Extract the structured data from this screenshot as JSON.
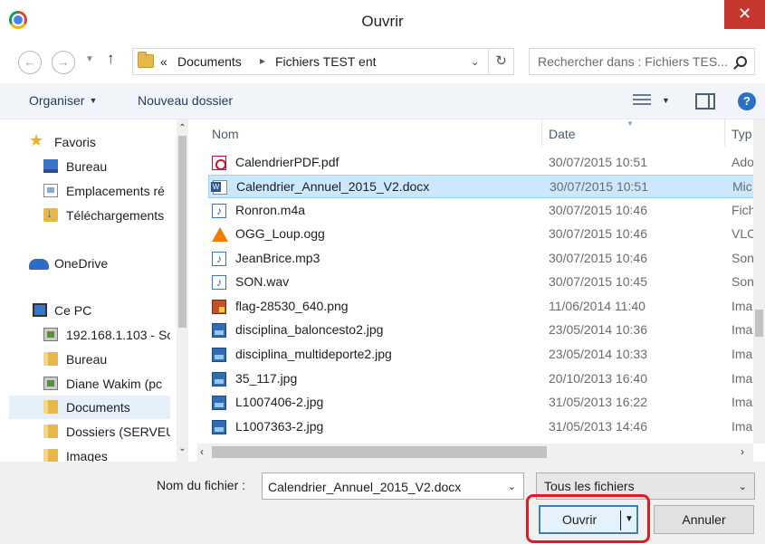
{
  "window": {
    "title": "Ouvrir",
    "close_glyph": "✕"
  },
  "address": {
    "breadcrumb_prefix": "«",
    "crumbs": [
      "Documents",
      "Fichiers TEST ent"
    ],
    "search_placeholder": "Rechercher dans : Fichiers TES..."
  },
  "toolbar": {
    "organize_label": "Organiser",
    "new_folder_label": "Nouveau dossier",
    "help_glyph": "?"
  },
  "nav": {
    "items": [
      {
        "label": "Favoris",
        "icon": "star-icon"
      },
      {
        "label": "Bureau",
        "icon": "desktop-icon"
      },
      {
        "label": "Emplacements ré",
        "icon": "recent-places-icon"
      },
      {
        "label": "Téléchargements",
        "icon": "downloads-icon"
      },
      {
        "label": "OneDrive",
        "icon": "onedrive-icon"
      },
      {
        "label": "Ce PC",
        "icon": "computer-icon"
      },
      {
        "label": "192.168.1.103 - Sc",
        "icon": "network-drive-icon"
      },
      {
        "label": "Bureau",
        "icon": "desktop-folder-icon"
      },
      {
        "label": "Diane Wakim (pc",
        "icon": "network-drive-icon"
      },
      {
        "label": "Documents",
        "icon": "documents-folder-icon"
      },
      {
        "label": "Dossiers (SERVEU",
        "icon": "folder-icon"
      },
      {
        "label": "Images",
        "icon": "folder-icon"
      }
    ]
  },
  "files": {
    "columns": {
      "name": "Nom",
      "date": "Date",
      "type": "Typ"
    },
    "rows": [
      {
        "name": "CalendrierPDF.pdf",
        "date": "30/07/2015 10:51",
        "type": "Ado",
        "icon": "pdf-file-icon"
      },
      {
        "name": "Calendrier_Annuel_2015_V2.docx",
        "date": "30/07/2015 10:51",
        "type": "Mic",
        "icon": "word-file-icon"
      },
      {
        "name": "Ronron.m4a",
        "date": "30/07/2015 10:46",
        "type": "Fich",
        "icon": "audio-file-icon"
      },
      {
        "name": "OGG_Loup.ogg",
        "date": "30/07/2015 10:46",
        "type": "VLC",
        "icon": "vlc-file-icon"
      },
      {
        "name": "JeanBrice.mp3",
        "date": "30/07/2015 10:46",
        "type": "Son",
        "icon": "audio-file-icon"
      },
      {
        "name": "SON.wav",
        "date": "30/07/2015 10:45",
        "type": "Son",
        "icon": "audio-file-icon"
      },
      {
        "name": "flag-28530_640.png",
        "date": "11/06/2014 11:40",
        "type": "Ima",
        "icon": "png-file-icon"
      },
      {
        "name": "disciplina_baloncesto2.jpg",
        "date": "23/05/2014 10:36",
        "type": "Ima",
        "icon": "image-file-icon"
      },
      {
        "name": "disciplina_multideporte2.jpg",
        "date": "23/05/2014 10:33",
        "type": "Ima",
        "icon": "image-file-icon"
      },
      {
        "name": "35_117.jpg",
        "date": "20/10/2013 16:40",
        "type": "Ima",
        "icon": "image-file-icon"
      },
      {
        "name": "L1007406-2.jpg",
        "date": "31/05/2013 16:22",
        "type": "Ima",
        "icon": "image-file-icon"
      },
      {
        "name": "L1007363-2.jpg",
        "date": "31/05/2013 14:46",
        "type": "Ima",
        "icon": "image-file-icon"
      }
    ]
  },
  "footer": {
    "filename_label": "Nom du fichier :",
    "filename_value": "Calendrier_Annuel_2015_V2.docx",
    "filter_value": "Tous les fichiers",
    "open_label": "Ouvrir",
    "cancel_label": "Annuler"
  },
  "colors": {
    "accent": "#2a71c6",
    "selection": "#cce8ff",
    "close": "#c7372f",
    "highlight_ring": "#e01b24"
  }
}
